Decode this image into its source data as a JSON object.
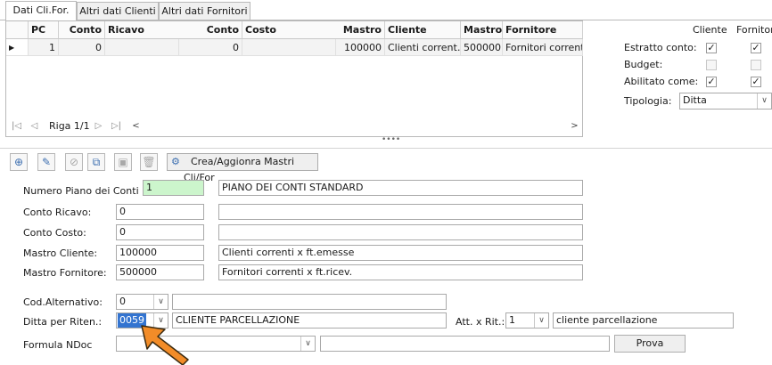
{
  "tabs": [
    "Dati Cli.For.",
    "Altri dati Clienti",
    "Altri dati Fornitori"
  ],
  "grid": {
    "columns": [
      "PC",
      "Conto",
      "Ricavo",
      "Conto",
      "Costo",
      "Mastro",
      "Cliente",
      "Mastro",
      "Fornitore"
    ],
    "row": [
      "1",
      "0",
      "",
      "0",
      "",
      "100000",
      "Clienti corrent…",
      "500000",
      "Fornitori correnti x"
    ],
    "nav_label": "Riga 1/1"
  },
  "options": {
    "col_cliente": "Cliente",
    "col_fornitore": "Fornitore",
    "rows": [
      {
        "label": "Estratto conto:",
        "cliente": true,
        "fornitore": true
      },
      {
        "label": "Budget:",
        "cliente": false,
        "fornitore": false
      },
      {
        "label": "Abilitato come:",
        "cliente": true,
        "fornitore": true
      }
    ],
    "tipologia_label": "Tipologia:",
    "tipologia_value": "Ditta"
  },
  "toolbar": {
    "crea_label": "Crea/Aggionra Mastri Cli/For"
  },
  "form": {
    "piano_label": "Numero Piano dei Conti",
    "piano_value": "1",
    "piano_desc": "PIANO DEI CONTI STANDARD",
    "ricavo_label": "Conto Ricavo:",
    "ricavo_value": "0",
    "ricavo_desc": "",
    "costo_label": "Conto Costo:",
    "costo_value": "0",
    "costo_desc": "",
    "mastro_cliente_label": "Mastro Cliente:",
    "mastro_cliente_value": "100000",
    "mastro_cliente_desc": "Clienti correnti x ft.emesse",
    "mastro_fornitore_label": "Mastro Fornitore:",
    "mastro_fornitore_value": "500000",
    "mastro_fornitore_desc": "Fornitori correnti x ft.ricev.",
    "cod_alt_label": "Cod.Alternativo:",
    "cod_alt_value": "0",
    "cod_alt_desc": "",
    "ditta_label": "Ditta per Riten.:",
    "ditta_value": "0059",
    "ditta_desc": "CLIENTE PARCELLAZIONE",
    "att_label": "Att. x Rit.:",
    "att_value": "1",
    "att_desc": "cliente parcellazione",
    "formula_label": "Formula NDoc",
    "formula_value": "",
    "formula_desc": "",
    "prova_label": "Prova"
  }
}
